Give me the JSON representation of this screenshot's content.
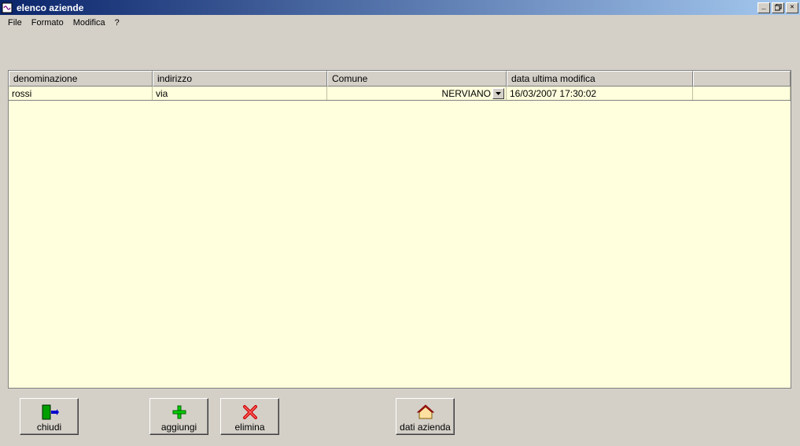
{
  "window": {
    "title": "elenco aziende"
  },
  "menu": {
    "file": "File",
    "formato": "Formato",
    "modifica": "Modifica",
    "help": "?"
  },
  "columns": {
    "denominazione": "denominazione",
    "indirizzo": "indirizzo",
    "comune": "Comune",
    "data_ultima_modifica": "data ultima modifica"
  },
  "rows": [
    {
      "denominazione": "rossi",
      "indirizzo": "via",
      "comune": "NERVIANO",
      "data_ultima_modifica": "16/03/2007 17:30:02"
    }
  ],
  "buttons": {
    "chiudi": "chiudi",
    "aggiungi": "aggiungi",
    "elimina": "elimina",
    "dati_azienda": "dati azienda"
  }
}
